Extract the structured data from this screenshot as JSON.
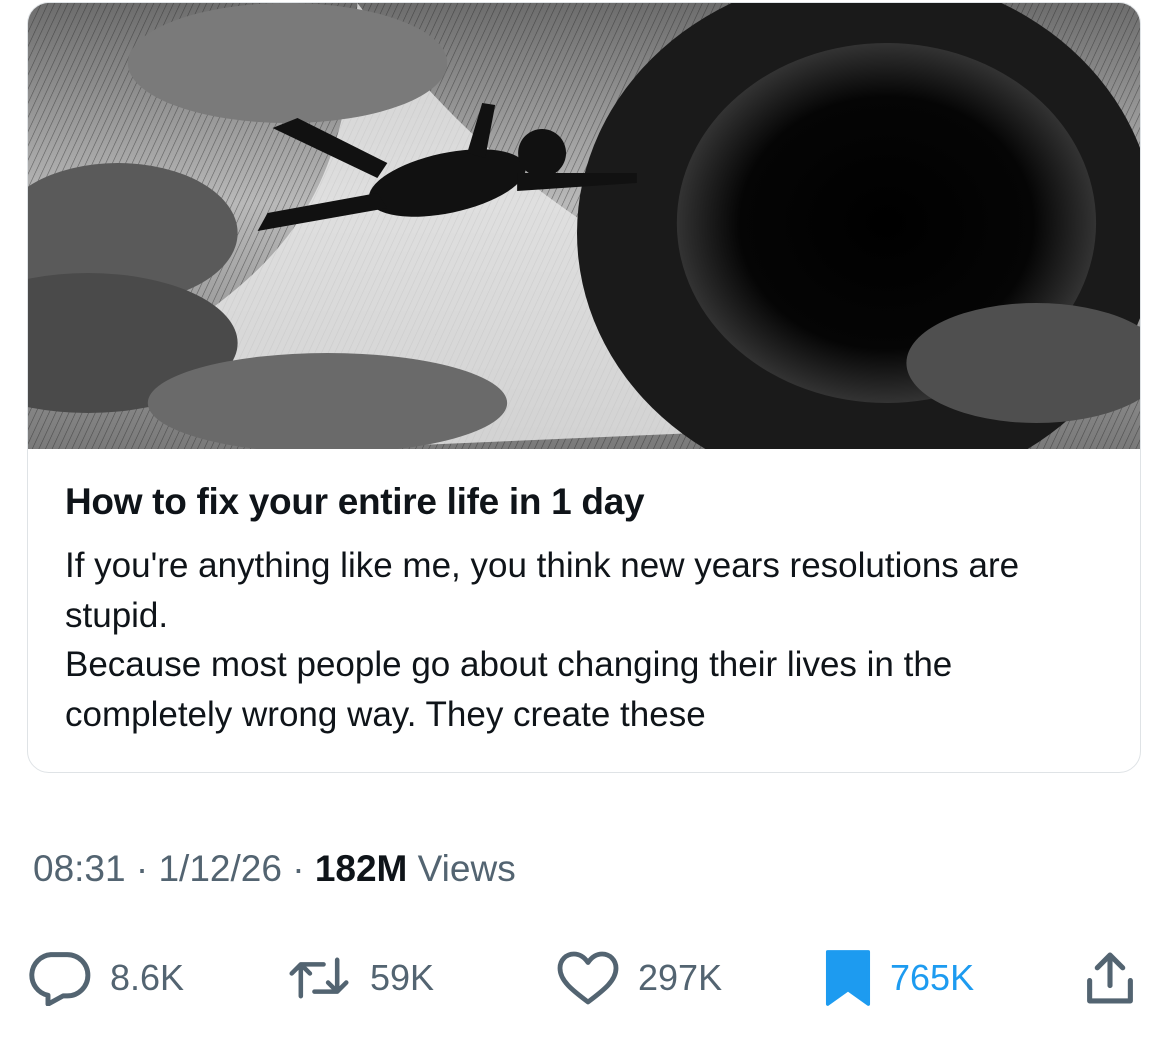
{
  "card": {
    "image_alt": "astronaut-falling-into-black-hole",
    "title": "How to fix your entire life in 1 day",
    "body": "If you're anything like me, you think new years resolutions are stupid.\nBecause most people go about changing their lives in the completely wrong way. They create these"
  },
  "meta": {
    "time": "08:31",
    "sep": "·",
    "date": "1/12/26",
    "views_count": "182M",
    "views_label": "Views"
  },
  "actions": {
    "replies": "8.6K",
    "reposts": "59K",
    "likes": "297K",
    "bookmarks": "765K"
  },
  "colors": {
    "text": "#0f1419",
    "secondary": "#536471",
    "accent": "#1d9bf0",
    "border": "#dfe3e6"
  },
  "icons": [
    "reply-icon",
    "repost-icon",
    "like-icon",
    "bookmark-icon",
    "share-icon"
  ]
}
